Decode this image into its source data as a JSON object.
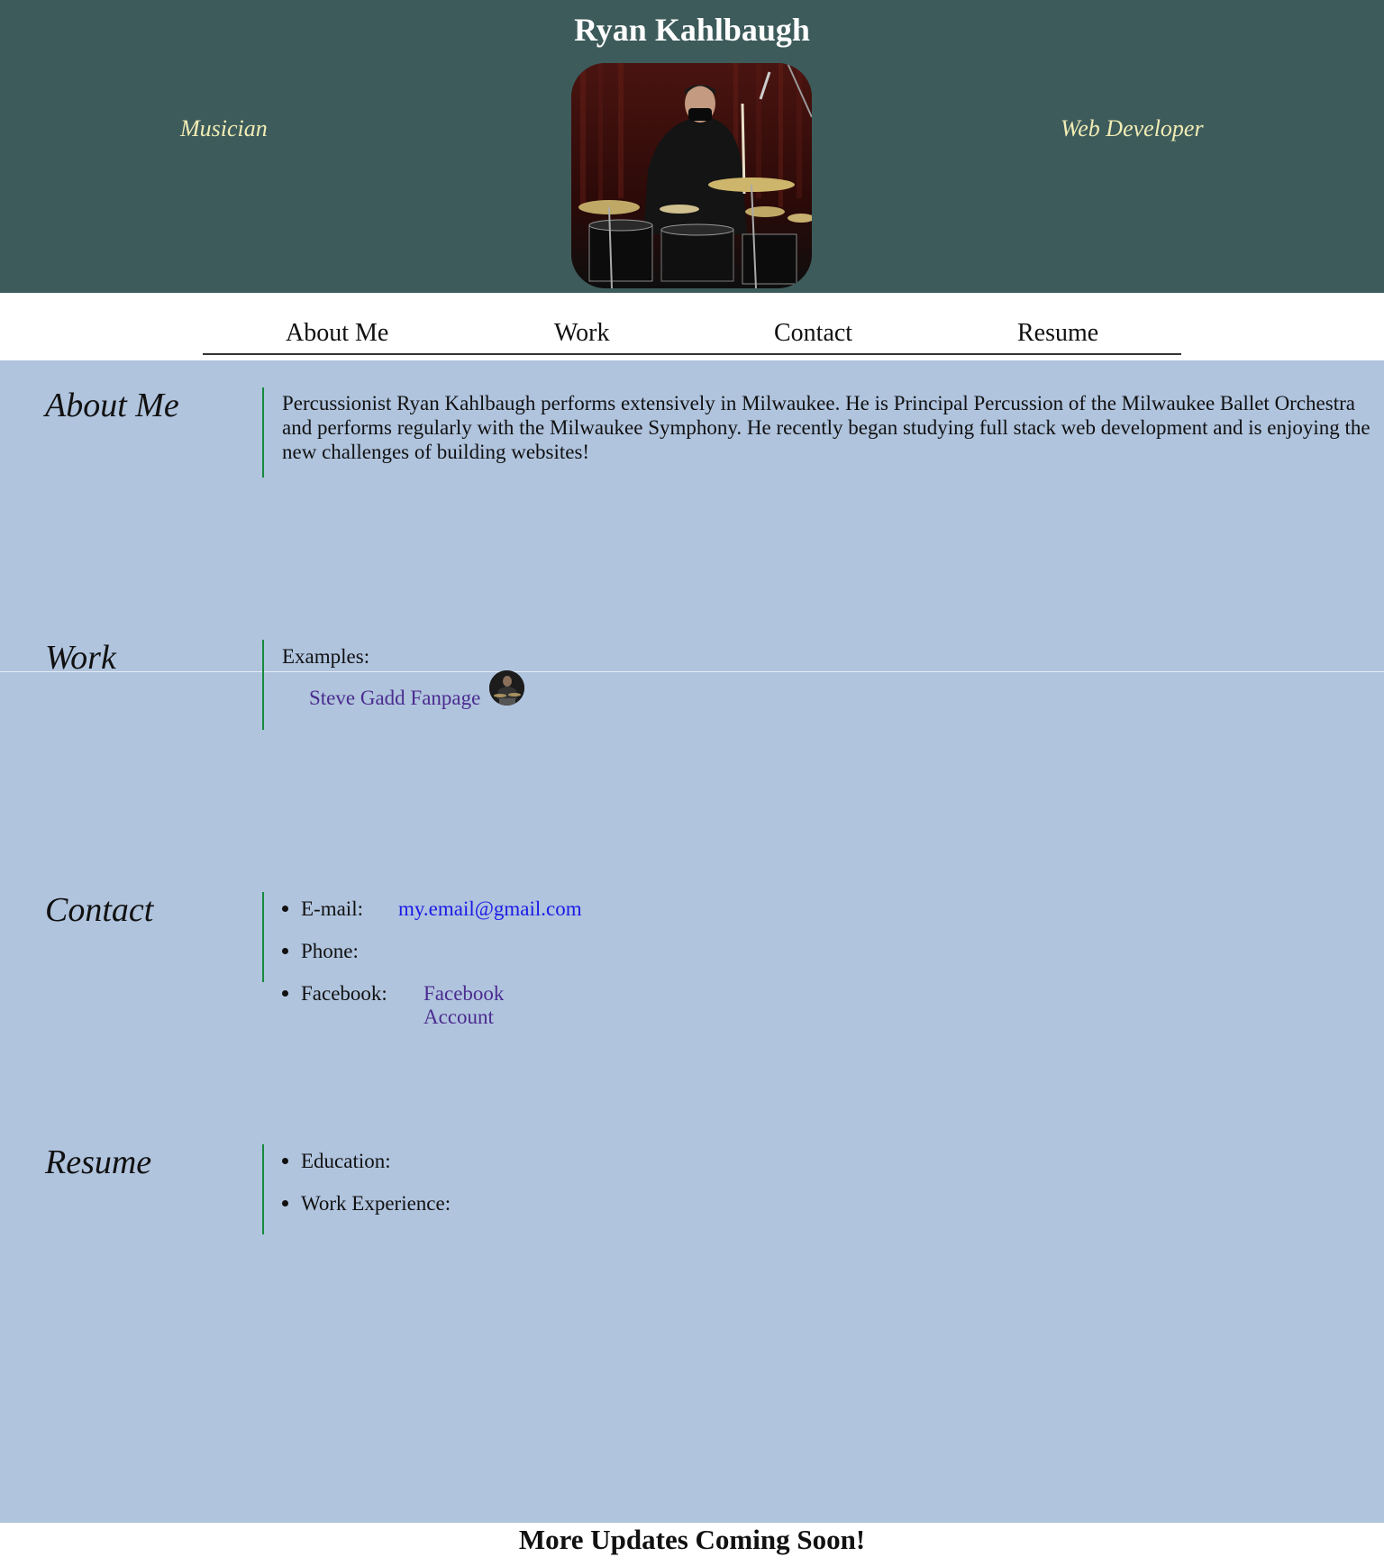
{
  "header": {
    "title": "Ryan Kahlbaugh",
    "tagline_left": "Musician",
    "tagline_right": "Web Developer",
    "bg_color": "#3d5b5b",
    "tagline_color": "#f1ecb4"
  },
  "nav": {
    "items": [
      {
        "label": "About Me"
      },
      {
        "label": "Work"
      },
      {
        "label": "Contact"
      },
      {
        "label": "Resume"
      }
    ]
  },
  "sections": {
    "about": {
      "title": "About Me",
      "text": "Percussionist Ryan Kahlbaugh performs extensively in Milwaukee. He is Principal Percussion of the Milwaukee Ballet Orchestra and performs regularly with the Milwaukee Symphony. He recently began studying full stack web development and is enjoying the new challenges of building websites!"
    },
    "work": {
      "title": "Work",
      "examples_label": "Examples:",
      "link_label": "Steve Gadd Fanpage"
    },
    "contact": {
      "title": "Contact",
      "items": [
        {
          "label": "E-mail:",
          "value": "my.email@gmail.com"
        },
        {
          "label": "Phone:",
          "value": ""
        },
        {
          "label": "Facebook:",
          "value": "Facebook Account"
        }
      ]
    },
    "resume": {
      "title": "Resume",
      "items": [
        {
          "label": "Education:"
        },
        {
          "label": "Work Experience:"
        }
      ]
    }
  },
  "footer": {
    "text": "More Updates Coming Soon!"
  },
  "colors": {
    "main_bg": "#b0c4de",
    "accent_rule": "#188a3e",
    "link_visited": "#4b2c8f",
    "link": "#1a1ae6"
  }
}
